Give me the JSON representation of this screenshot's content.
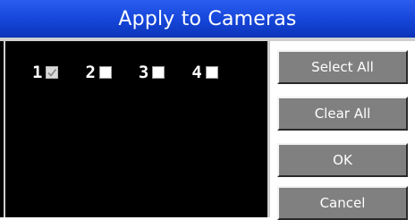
{
  "dialog": {
    "title": "Apply to Cameras"
  },
  "cameras": [
    {
      "number": "1",
      "checked": true,
      "disabled": true
    },
    {
      "number": "2",
      "checked": false,
      "disabled": false
    },
    {
      "number": "3",
      "checked": false,
      "disabled": false
    },
    {
      "number": "4",
      "checked": false,
      "disabled": false
    }
  ],
  "buttons": {
    "select_all": "Select All",
    "clear_all": "Clear All",
    "ok": "OK",
    "cancel": "Cancel"
  },
  "colors": {
    "title_bar": "#1545d8",
    "panel_background": "#000000",
    "button_face": "#808080",
    "text": "#ffffff"
  },
  "icons": {
    "checkbox_checked": "checkmark-icon"
  }
}
